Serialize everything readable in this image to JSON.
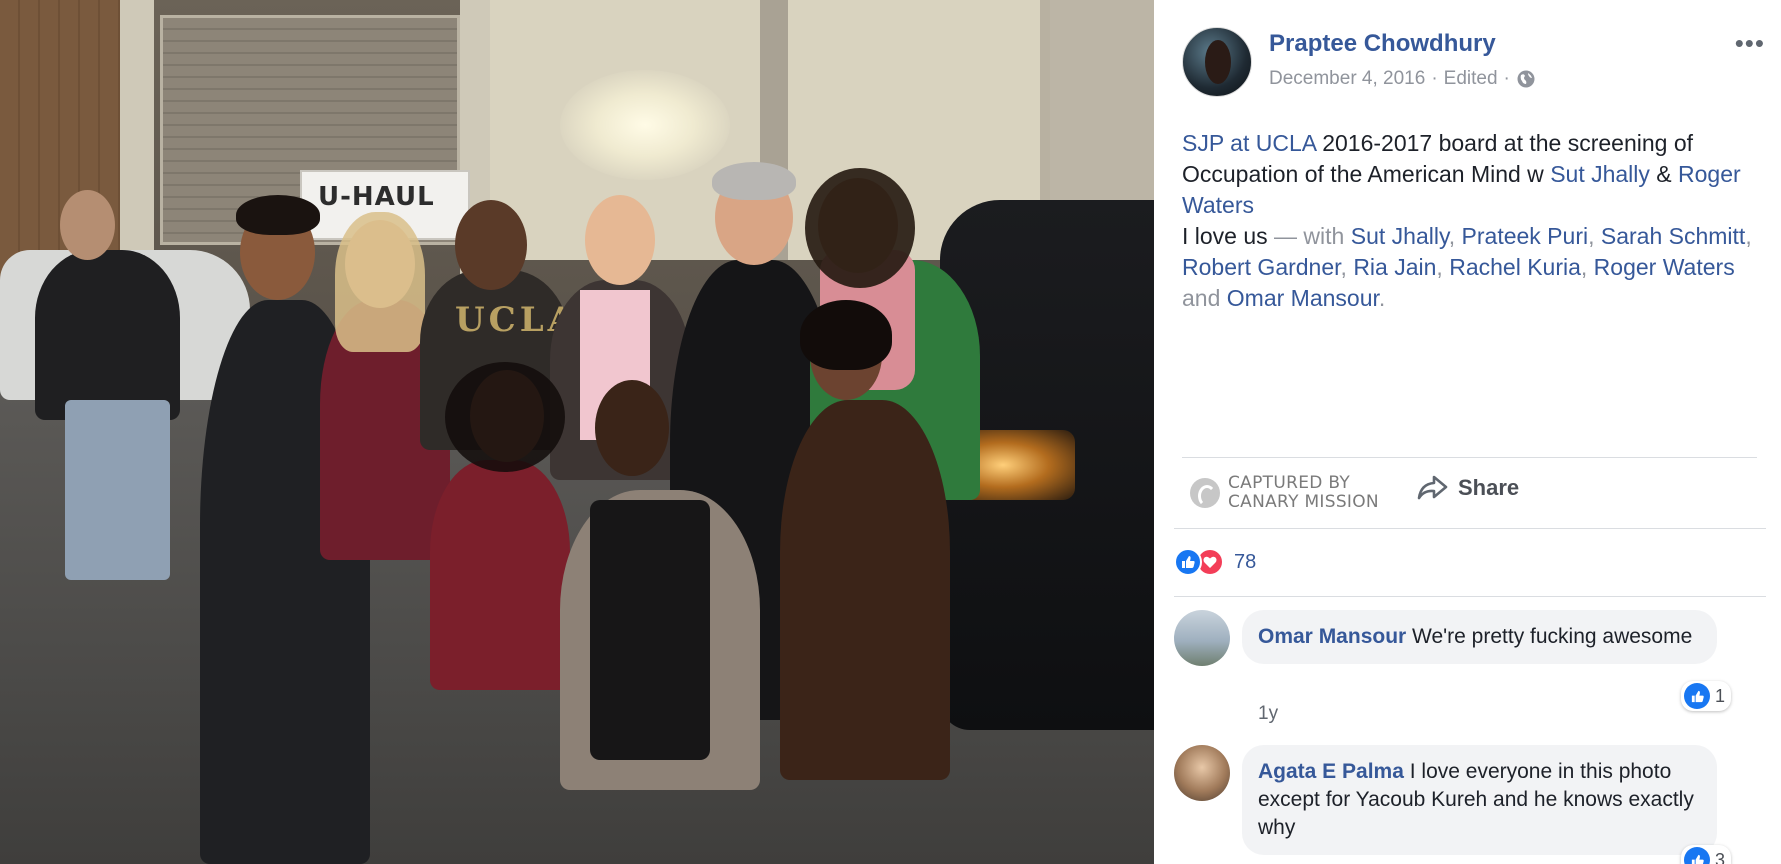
{
  "post": {
    "author": "Praptee Chowdhury",
    "date": "December 4, 2016",
    "edited": "Edited",
    "more_label": "•••",
    "text": {
      "line_link_1": "SJP at UCLA",
      "line_text_1": " 2016-2017 board at the screening of Occupation of the American Mind w ",
      "link_2": "Sut Jhally",
      "amp": " & ",
      "link_3": "Roger Waters",
      "love_text": "I love us",
      "with_text": " — with ",
      "tags": [
        "Sut Jhally",
        "Prateek Puri",
        "Sarah Schmitt",
        "Robert Gardner",
        "Ria Jain",
        "Rachel Kuria",
        "Roger Waters",
        "Omar Mansour"
      ],
      "and_text": " and ",
      "period": "."
    }
  },
  "actions": {
    "captured_line_1": "CAPTURED BY",
    "captured_line_2": "CANARY MISSION",
    "share_label": "Share"
  },
  "reactions": {
    "count": "78",
    "types": [
      "like-icon",
      "love-icon"
    ]
  },
  "comments": [
    {
      "name": "Omar Mansour",
      "text": "We're pretty fucking awesome",
      "time": "1y",
      "likes": "1"
    },
    {
      "name": "Agata E Palma",
      "text": "I love everyone in this photo except for Yacoub Kureh and he knows exactly why",
      "likes": "3"
    }
  ],
  "photo": {
    "sign_text": "U-HAUL",
    "shirt_text": "UCLA"
  },
  "colors": {
    "link": "#365899",
    "meta": "#90949c",
    "like_blue": "#1877f2",
    "love_red": "#f33e58"
  }
}
